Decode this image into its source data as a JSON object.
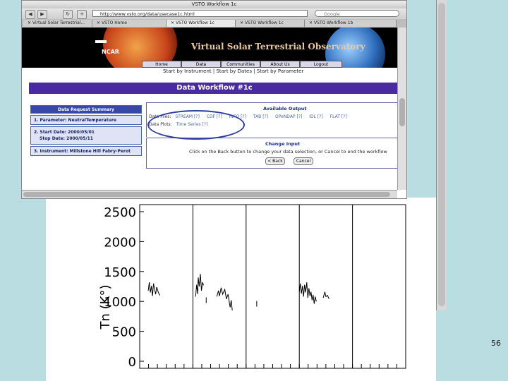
{
  "browser": {
    "window_title": "VSTO Workflow 1c",
    "url": "http://www.vsto.org/data/usecase1c.html",
    "search_placeholder": "Google",
    "nav_icons": [
      "back-icon",
      "forward-icon",
      "reload-icon",
      "add-icon"
    ],
    "tabs": [
      {
        "label": "Virtual Solar Terrestrial..."
      },
      {
        "label": "VSTO Home"
      },
      {
        "label": "VSTO Workflow 1c"
      },
      {
        "label": "VSTO Workflow 1c"
      },
      {
        "label": "VSTO Workflow 1b"
      }
    ]
  },
  "banner": {
    "title": "Virtual Solar Terrestrial Observatory",
    "logo_text": "NCAR",
    "nav": [
      "Home",
      "Data",
      "Communities",
      "About Us",
      "Logout"
    ],
    "subnav": "Start by Instrument | Start by Dates | Start by Parameter"
  },
  "workflow": {
    "title": "Data Workflow #1c",
    "summary": {
      "title": "Data Request Summary",
      "parameter": "1. Parameter: NeutralTemperature",
      "start_date": "2. Start Date: 2000/05/01",
      "stop_date": "Stop Date: 2000/05/11",
      "instrument": "3. Instrument: Millstone Hill Fabry-Perot"
    },
    "available_output": {
      "title": "Available Output",
      "data_files_label": "Data Files:",
      "data_files": [
        "STREAM [?]",
        "CDF [?]",
        "INFO [?]",
        "TAB [?]",
        "OPeNDAP [?]",
        "IDL [?]",
        "FLAT [?]"
      ],
      "data_plots_label": "Data Plots:",
      "data_plots": [
        "Time Series [?]"
      ]
    },
    "change_input": {
      "title": "Change Input",
      "text": "Click on the Back button to change your data selection, or Cancel to end the workflow",
      "back_label": "< Back",
      "cancel_label": "Cancel"
    }
  },
  "chart_data": {
    "type": "line",
    "ylabel": "Tn (K°)",
    "ylim": [
      0,
      2500
    ],
    "yticks": [
      0,
      500,
      1000,
      1500,
      2000,
      2500
    ],
    "panel_count": 5,
    "note_color": "#000000",
    "series": [
      {
        "segments": [
          [
            [
              0.16,
              1180
            ],
            [
              0.18,
              1320
            ],
            [
              0.2,
              1150
            ],
            [
              0.22,
              1260
            ],
            [
              0.24,
              1090
            ],
            [
              0.26,
              1300
            ],
            [
              0.28,
              1200
            ],
            [
              0.3,
              1120
            ],
            [
              0.32,
              1240
            ],
            [
              0.35,
              1150
            ],
            [
              0.38,
              1100
            ]
          ],
          [
            [
              1.05,
              1080
            ],
            [
              1.07,
              1280
            ],
            [
              1.09,
              1120
            ],
            [
              1.1,
              1400
            ],
            [
              1.12,
              1250
            ],
            [
              1.14,
              1460
            ],
            [
              1.16,
              1180
            ],
            [
              1.18,
              1320
            ],
            [
              1.2,
              1270
            ]
          ],
          [
            [
              1.25,
              1020
            ]
          ],
          [
            [
              1.45,
              1080
            ],
            [
              1.48,
              1180
            ],
            [
              1.5,
              1090
            ],
            [
              1.53,
              1230
            ],
            [
              1.56,
              1120
            ],
            [
              1.6,
              1200
            ],
            [
              1.63,
              1040
            ],
            [
              1.66,
              1120
            ],
            [
              1.7,
              900
            ],
            [
              1.72,
              1020
            ],
            [
              1.74,
              850
            ]
          ],
          [
            [
              2.2,
              960
            ]
          ],
          [
            [
              3.0,
              1160
            ],
            [
              3.02,
              1300
            ],
            [
              3.04,
              1130
            ],
            [
              3.06,
              1260
            ],
            [
              3.08,
              1080
            ],
            [
              3.1,
              1280
            ],
            [
              3.12,
              1150
            ],
            [
              3.14,
              1320
            ],
            [
              3.16,
              1060
            ],
            [
              3.18,
              1220
            ],
            [
              3.2,
              1090
            ],
            [
              3.22,
              1160
            ],
            [
              3.24,
              1020
            ],
            [
              3.26,
              1110
            ],
            [
              3.28,
              960
            ],
            [
              3.3,
              1080
            ],
            [
              3.32,
              1000
            ]
          ],
          [
            [
              3.45,
              1060
            ],
            [
              3.48,
              1160
            ],
            [
              3.5,
              1080
            ],
            [
              3.53,
              1100
            ],
            [
              3.56,
              1040
            ]
          ]
        ]
      }
    ]
  },
  "page_number": "56"
}
